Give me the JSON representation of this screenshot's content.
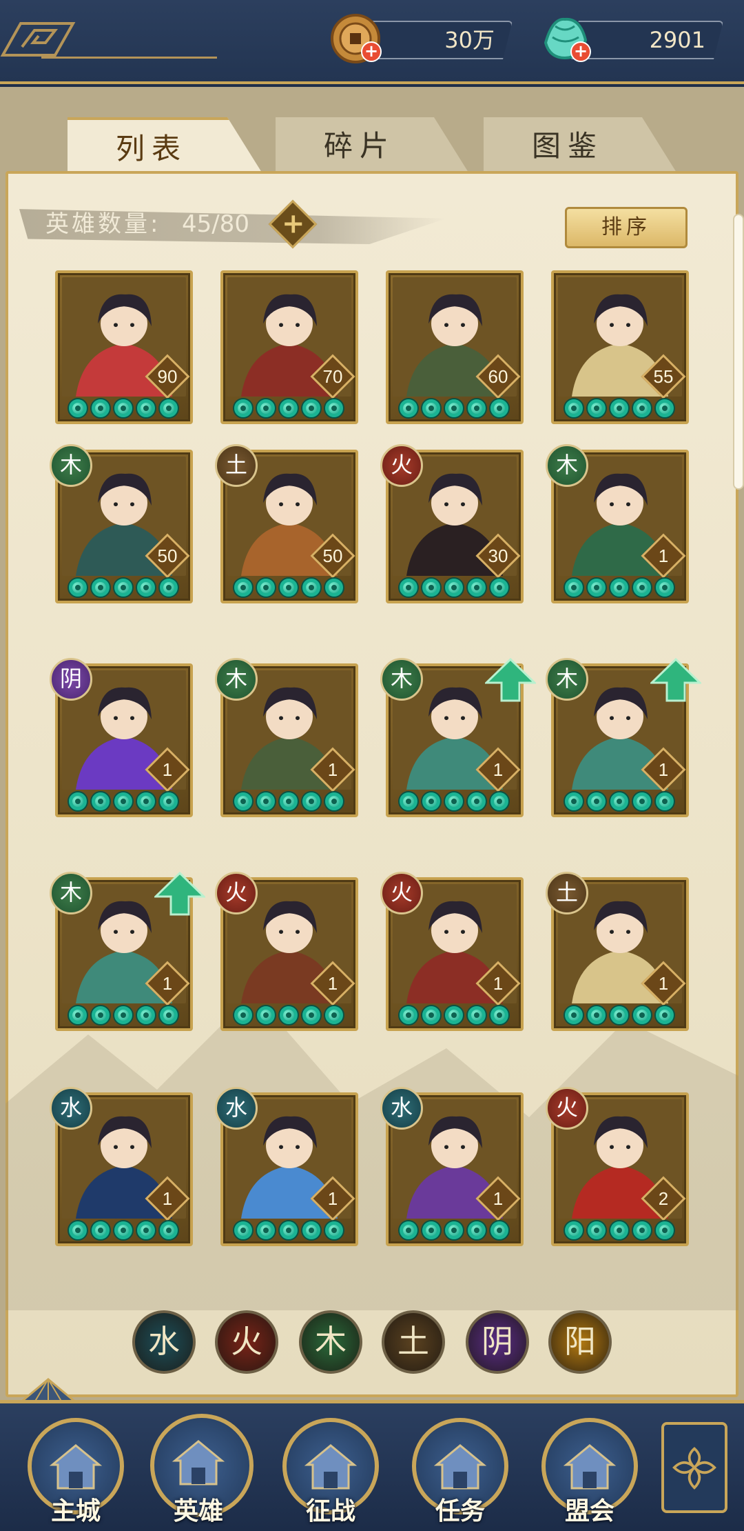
{
  "header": {
    "coins": "30万",
    "gems": "2901",
    "coin_icon": "copper-coin-icon",
    "gem_icon": "jade-shell-icon"
  },
  "tabs": [
    {
      "label": "列表",
      "active": true
    },
    {
      "label": "碎片",
      "active": false
    },
    {
      "label": "图鉴",
      "active": false
    }
  ],
  "hero_count": {
    "label": "英雄数量:",
    "value": "45/80"
  },
  "sort_label": "排序",
  "heroes": [
    {
      "level": "90",
      "element": "",
      "upgrade": false,
      "palette": "#c43a3a"
    },
    {
      "level": "70",
      "element": "",
      "upgrade": false,
      "palette": "#8c2e25"
    },
    {
      "level": "60",
      "element": "",
      "upgrade": false,
      "palette": "#4a5f3a"
    },
    {
      "level": "55",
      "element": "",
      "upgrade": false,
      "palette": "#d8c48a"
    },
    {
      "level": "50",
      "element": "木",
      "upgrade": false,
      "palette": "#2e5a56"
    },
    {
      "level": "50",
      "element": "土",
      "upgrade": false,
      "palette": "#a8642c"
    },
    {
      "level": "30",
      "element": "火",
      "upgrade": false,
      "palette": "#2a2022"
    },
    {
      "level": "1",
      "element": "木",
      "upgrade": false,
      "palette": "#2f6a48"
    },
    {
      "level": "1",
      "element": "阴",
      "upgrade": false,
      "palette": "#6b3ac2"
    },
    {
      "level": "1",
      "element": "木",
      "upgrade": false,
      "palette": "#4a5f3a"
    },
    {
      "level": "1",
      "element": "木",
      "upgrade": true,
      "palette": "#3f8a7a"
    },
    {
      "level": "1",
      "element": "木",
      "upgrade": true,
      "palette": "#3f8a7a"
    },
    {
      "level": "1",
      "element": "木",
      "upgrade": true,
      "palette": "#3f8a7a"
    },
    {
      "level": "1",
      "element": "火",
      "upgrade": false,
      "palette": "#7a3a22"
    },
    {
      "level": "1",
      "element": "火",
      "upgrade": false,
      "palette": "#8c2e25"
    },
    {
      "level": "1",
      "element": "土",
      "upgrade": false,
      "palette": "#d8c48a"
    },
    {
      "level": "1",
      "element": "水",
      "upgrade": false,
      "palette": "#1f3a6a"
    },
    {
      "level": "1",
      "element": "水",
      "upgrade": false,
      "palette": "#4a8ad0"
    },
    {
      "level": "1",
      "element": "水",
      "upgrade": false,
      "palette": "#6a3a9a"
    },
    {
      "level": "2",
      "element": "火",
      "upgrade": false,
      "palette": "#b52a22"
    }
  ],
  "element_filters": [
    {
      "glyph": "水",
      "name": "water",
      "color": "#1d4f59"
    },
    {
      "glyph": "火",
      "name": "fire",
      "color": "#7a2418"
    },
    {
      "glyph": "木",
      "name": "wood",
      "color": "#2a6a3a"
    },
    {
      "glyph": "土",
      "name": "earth",
      "color": "#5b4220"
    },
    {
      "glyph": "阴",
      "name": "yin",
      "color": "#5a2d86"
    },
    {
      "glyph": "阳",
      "name": "yang",
      "color": "#b47a10"
    }
  ],
  "nav": [
    {
      "label": "主城",
      "icon": "city-gate-icon"
    },
    {
      "label": "英雄",
      "icon": "hero-portrait-icon",
      "active": true
    },
    {
      "label": "征战",
      "icon": "campaign-banner-icon"
    },
    {
      "label": "任务",
      "icon": "quest-scroll-icon"
    },
    {
      "label": "盟会",
      "icon": "alliance-pavilion-icon"
    }
  ],
  "colors": {
    "gold": "#c9a659",
    "navy": "#233552",
    "paper": "#f2ead4",
    "jade": "#17a487"
  }
}
